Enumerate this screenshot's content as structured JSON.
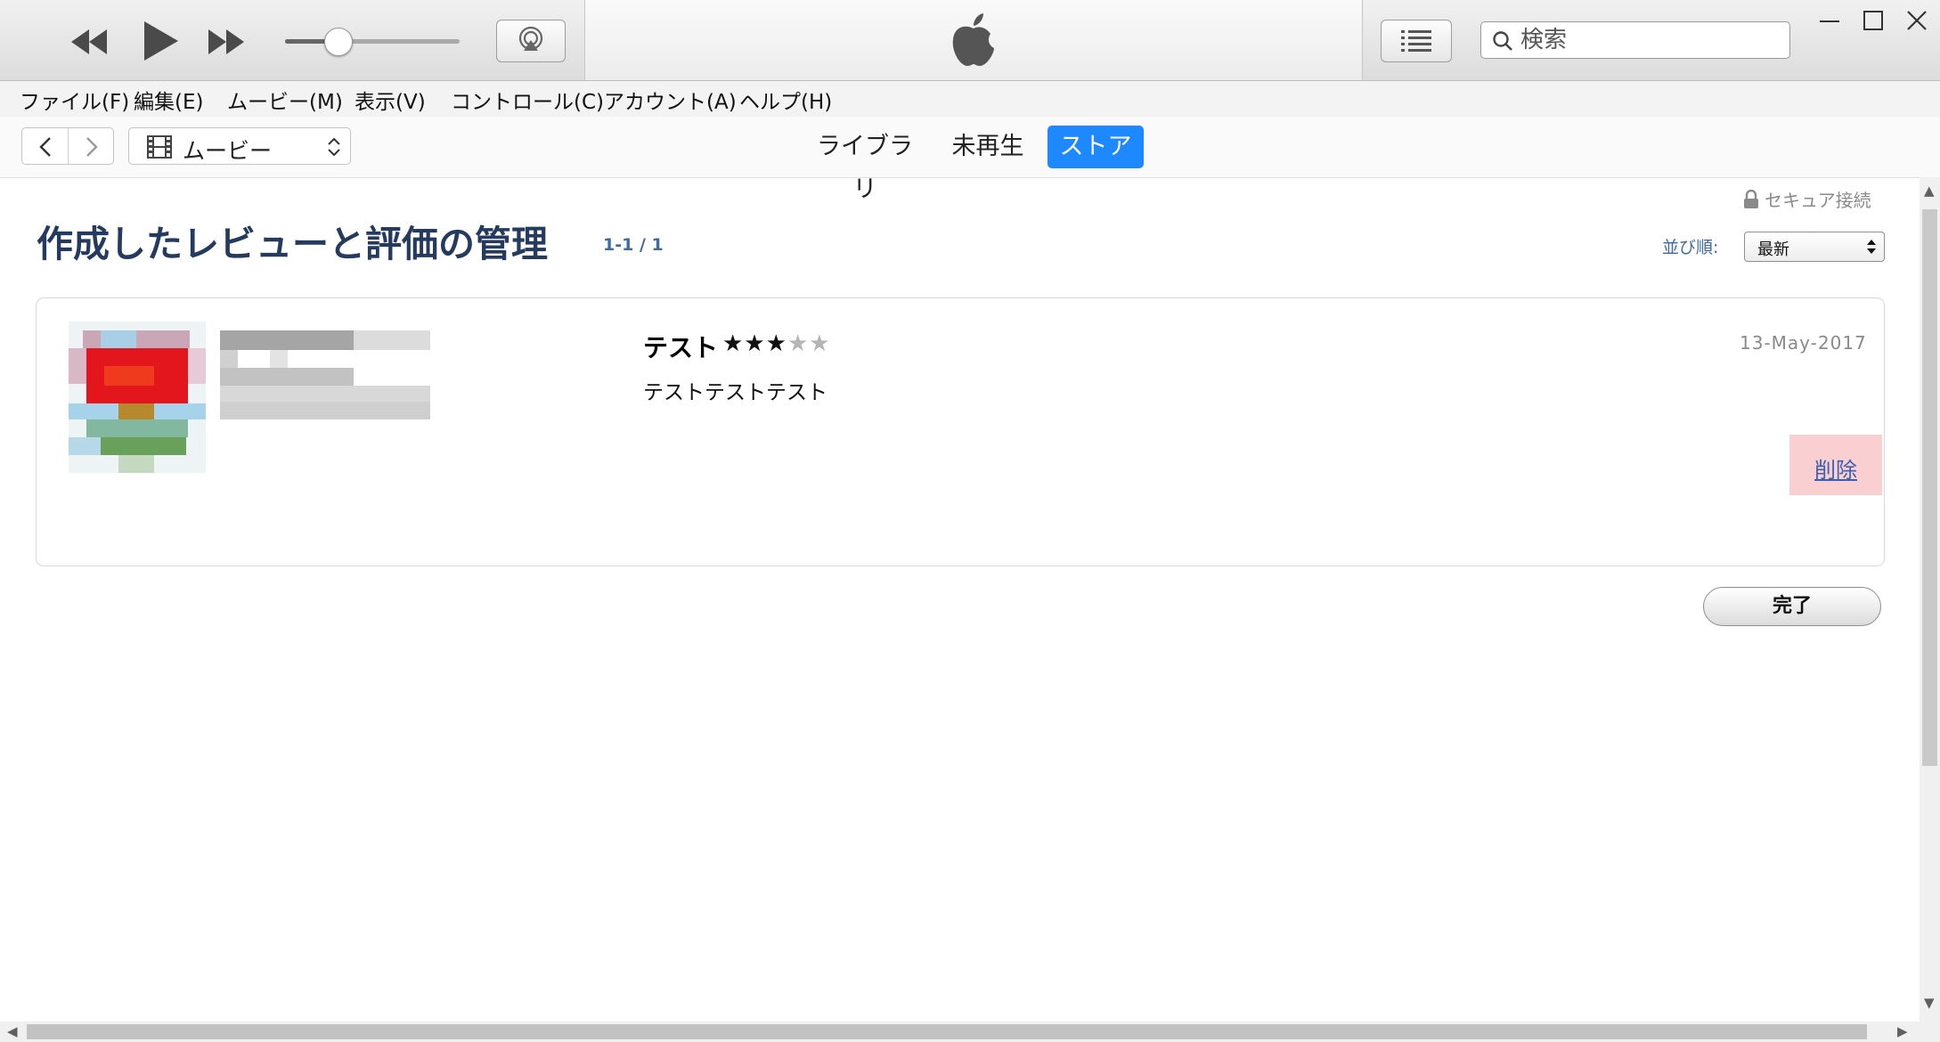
{
  "window": {
    "app": "iTunes"
  },
  "search": {
    "placeholder": "検索"
  },
  "menu": {
    "items": [
      "ファイル(F)",
      "編集(E)",
      "ムービー(M)",
      "表示(V)",
      "コントロール(C)",
      "アカウント(A)",
      "ヘルプ(H)"
    ]
  },
  "nav": {
    "media": "ムービー",
    "tabs": [
      "ライブラリ",
      "未再生",
      "ストア"
    ],
    "active_tab": "ストア"
  },
  "player": {
    "volume_fraction": 0.3
  },
  "page": {
    "secure": "セキュア接続",
    "title": "作成したレビューと評価の管理",
    "count": "1-1 / 1",
    "sort_label": "並び順:",
    "sort_value": "最新"
  },
  "review": {
    "title": "テスト",
    "rating": 3,
    "rating_max": 5,
    "date": "13-May-2017",
    "body": "テストテストテスト",
    "delete_label": "削除"
  },
  "footer": {
    "done_label": "完了"
  },
  "colors": {
    "accent": "#1e88ff",
    "title": "#243a5e",
    "link": "#3a5fb0",
    "delete_bg": "#f9cfd1"
  },
  "icons": [
    "rewind-icon",
    "play-icon",
    "fast-forward-icon",
    "airplay-icon",
    "apple-logo-icon",
    "list-view-icon",
    "search-icon",
    "minimize-icon",
    "maximize-icon",
    "close-icon",
    "back-icon",
    "forward-icon",
    "film-icon",
    "updown-icon",
    "lock-icon"
  ]
}
